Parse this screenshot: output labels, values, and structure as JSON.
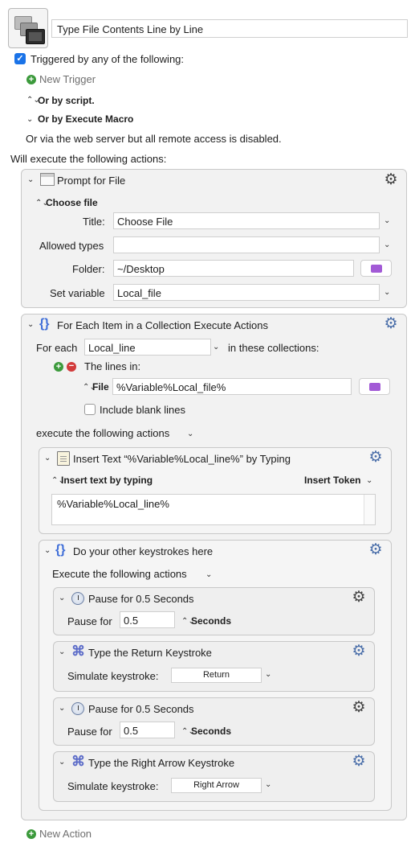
{
  "macro": {
    "name": "Type File Contents Line by Line",
    "icon": "macro-windows-icon"
  },
  "triggers": {
    "checkbox_label": "Triggered by any of the following:",
    "checked": true,
    "new_trigger": "New Trigger",
    "or_by_script": "Or by script.",
    "or_by_execute_macro": "Or by Execute Macro",
    "web_server_note": "Or via the web server but all remote access is disabled."
  },
  "will_execute": "Will execute the following actions:",
  "prompt_for_file": {
    "title": "Prompt for File",
    "choose_file": "Choose file",
    "title_label": "Title:",
    "title_value": "Choose File",
    "allowed_types_label": "Allowed types",
    "allowed_types_value": "",
    "folder_label": "Folder:",
    "folder_value": "~/Desktop",
    "set_variable_label": "Set variable",
    "set_variable_value": "Local_file"
  },
  "for_each": {
    "title": "For Each Item in a Collection Execute Actions",
    "for_each_label": "For each",
    "variable": "Local_line",
    "in_collections": "in these collections:",
    "lines_in": "The lines in:",
    "file_label": "File",
    "file_value": "%Variable%Local_file%",
    "include_blank": "Include blank lines",
    "include_blank_checked": false,
    "execute_label": "execute the following actions"
  },
  "insert_text": {
    "title": "Insert Text “%Variable%Local_line%” by Typing",
    "mode": "Insert text by typing",
    "insert_token": "Insert Token",
    "text": "%Variable%Local_line%"
  },
  "group": {
    "title": "Do your other keystrokes here",
    "execute_label": "Execute the following actions"
  },
  "pause1": {
    "title": "Pause for 0.5 Seconds",
    "label": "Pause for",
    "value": "0.5",
    "unit": "Seconds"
  },
  "keystroke1": {
    "title": "Type the Return Keystroke",
    "label": "Simulate keystroke:",
    "value": "Return"
  },
  "pause2": {
    "title": "Pause for 0.5 Seconds",
    "label": "Pause for",
    "value": "0.5",
    "unit": "Seconds"
  },
  "keystroke2": {
    "title": "Type the Right Arrow Keystroke",
    "label": "Simulate keystroke:",
    "value": "Right Arrow"
  },
  "new_action": "New Action",
  "colors": {
    "accent": "#1a73e8",
    "add_green": "#3c9a3c",
    "remove_red": "#d23b3b",
    "folder_purple": "#a25ad6",
    "braces_blue": "#3f6ed8"
  }
}
